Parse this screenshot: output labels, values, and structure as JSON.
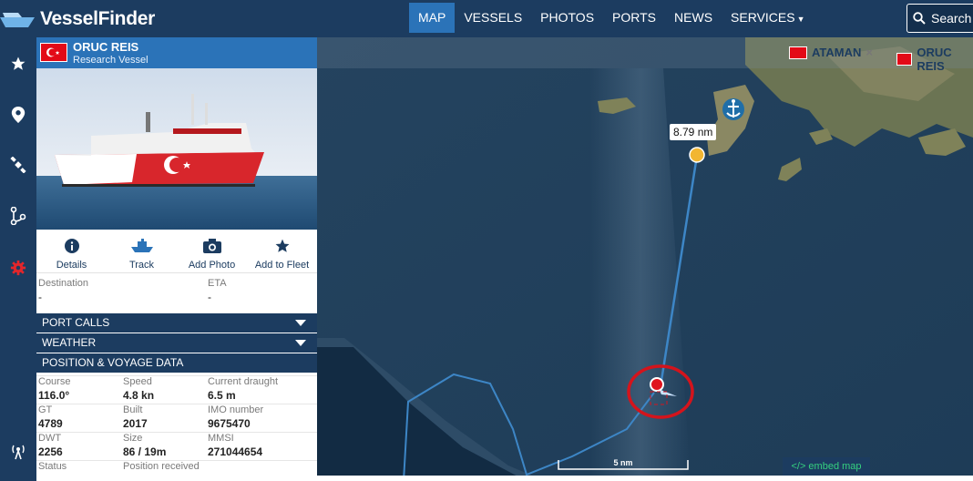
{
  "brand": {
    "logo_text": "VesselFinder"
  },
  "nav": {
    "items": [
      {
        "label": "MAP",
        "active": true
      },
      {
        "label": "VESSELS",
        "active": false
      },
      {
        "label": "PHOTOS",
        "active": false
      },
      {
        "label": "PORTS",
        "active": false
      },
      {
        "label": "NEWS",
        "active": false
      },
      {
        "label": "SERVICES",
        "active": false
      }
    ],
    "search_label": "Search S"
  },
  "sidebar_icons": [
    "star-icon",
    "map-pin-icon",
    "satellite-icon",
    "route-icon",
    "settings-gear-icon",
    "antenna-icon"
  ],
  "vessel": {
    "name": "ORUC REIS",
    "type": "Research Vessel",
    "flag": "Turkey",
    "actions": [
      {
        "label": "Details",
        "icon": "info-icon"
      },
      {
        "label": "Track",
        "icon": "ship-icon"
      },
      {
        "label": "Add Photo",
        "icon": "camera-icon"
      },
      {
        "label": "Add to Fleet",
        "icon": "star-icon"
      }
    ],
    "destination_label": "Destination",
    "destination_value": "-",
    "eta_label": "ETA",
    "eta_value": "-",
    "sections": {
      "port_calls": "PORT CALLS",
      "weather": "WEATHER",
      "position_voyage": "POSITION & VOYAGE DATA"
    },
    "voyage": {
      "course_label": "Course",
      "course_value": "116.0°",
      "speed_label": "Speed",
      "speed_value": "4.8 kn",
      "draught_label": "Current draught",
      "draught_value": "6.5 m",
      "gt_label": "GT",
      "gt_value": "4789",
      "built_label": "Built",
      "built_value": "2017",
      "imo_label": "IMO number",
      "imo_value": "9675470",
      "dwt_label": "DWT",
      "dwt_value": "2256",
      "size_label": "Size",
      "size_value": "86 / 19m",
      "mmsi_label": "MMSI",
      "mmsi_value": "271044654",
      "status_label": "Status",
      "position_received_label": "Position received"
    }
  },
  "map": {
    "fleet_tags": [
      {
        "label": "ATAMAN",
        "closable": true
      },
      {
        "label": "ORUC REIS",
        "closable": false
      }
    ],
    "distance_label": "8.79 nm",
    "scale_label": "5 nm",
    "embed_label": "</> embed map",
    "colors": {
      "sea": "#22415c",
      "track": "#3d86c6",
      "vessel_marker": "#e0141e",
      "highlight_circle": "#d4141c",
      "anchor_marker": "#e8a51c"
    }
  }
}
